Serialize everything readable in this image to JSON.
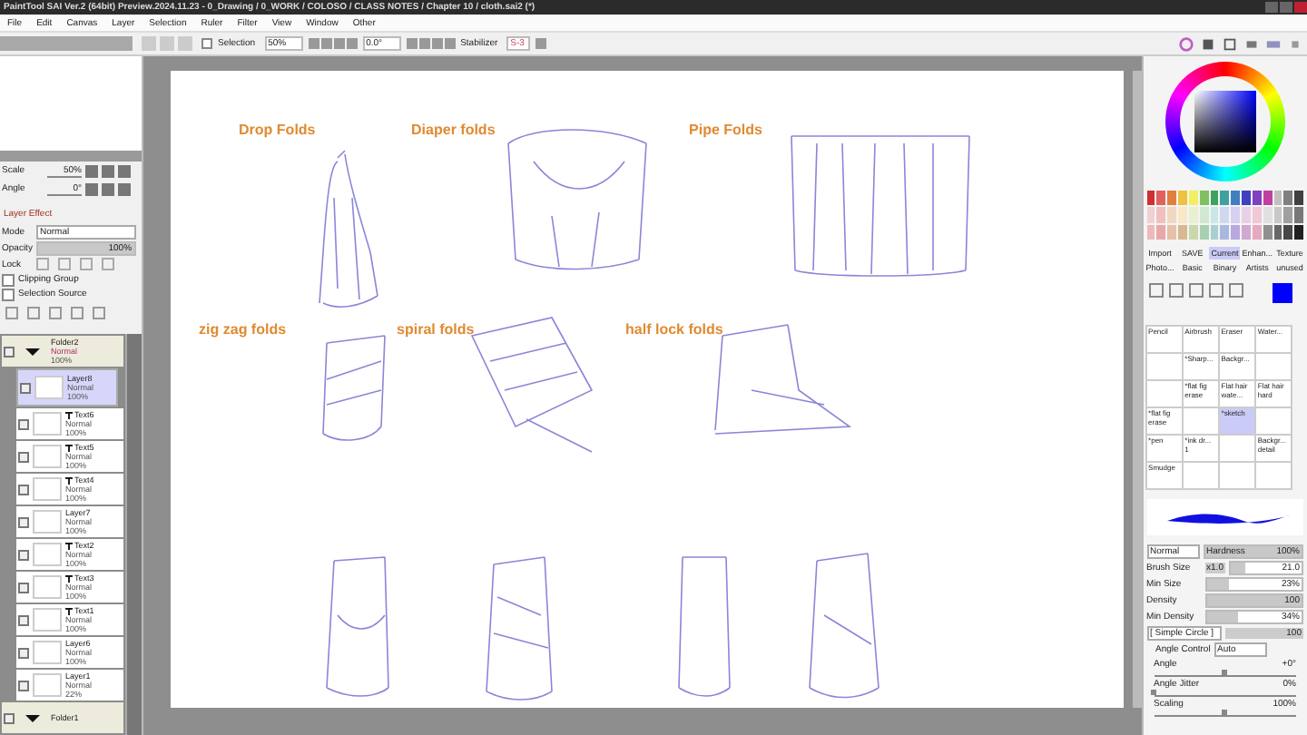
{
  "window": {
    "title": "PaintTool SAI Ver.2 (64bit) Preview.2024.11.23 - 0_Drawing / 0_WORK / COLOSO / CLASS NOTES / Chapter 10 / cloth.sai2 (*)"
  },
  "menu": [
    "File",
    "Edit",
    "Canvas",
    "Layer",
    "Selection",
    "Ruler",
    "Filter",
    "View",
    "Window",
    "Other"
  ],
  "toolbar": {
    "selection_label": "Selection",
    "zoom": "50%",
    "angle": "0.0°",
    "stabilizer_label": "Stabilizer",
    "stabilizer": "S-3"
  },
  "navigator": {
    "scale_label": "Scale",
    "scale": "50%",
    "angle_label": "Angle",
    "angle": "0°"
  },
  "layer_panel": {
    "effect": "Layer Effect",
    "mode_label": "Mode",
    "mode": "Normal",
    "opacity_label": "Opacity",
    "opacity": {
      "text": "100%",
      "level": 1
    },
    "lock_label": "Lock",
    "clipping_group": {
      "label": "Clipping Group",
      "checked": false
    },
    "selection_source": {
      "label": "Selection Source",
      "checked": false
    }
  },
  "layers": [
    {
      "kind": "folder",
      "name": "Folder2",
      "mode": "Normal",
      "opacity": "100%",
      "selected": false
    },
    {
      "kind": "layer",
      "name": "Layer8",
      "mode": "Normal",
      "opacity": "100%",
      "selected": true
    },
    {
      "kind": "text",
      "name": "Text6",
      "mode": "Normal",
      "opacity": "100%",
      "selected": false
    },
    {
      "kind": "text",
      "name": "Text5",
      "mode": "Normal",
      "opacity": "100%",
      "selected": false
    },
    {
      "kind": "text",
      "name": "Text4",
      "mode": "Normal",
      "opacity": "100%",
      "selected": false
    },
    {
      "kind": "layer",
      "name": "Layer7",
      "mode": "Normal",
      "opacity": "100%",
      "selected": false
    },
    {
      "kind": "text",
      "name": "Text2",
      "mode": "Normal",
      "opacity": "100%",
      "selected": false
    },
    {
      "kind": "text",
      "name": "Text3",
      "mode": "Normal",
      "opacity": "100%",
      "selected": false
    },
    {
      "kind": "text",
      "name": "Text1",
      "mode": "Normal",
      "opacity": "100%",
      "selected": false
    },
    {
      "kind": "layer",
      "name": "Layer6",
      "mode": "Normal",
      "opacity": "100%",
      "selected": false
    },
    {
      "kind": "layer",
      "name": "Layer1",
      "mode": "Normal",
      "opacity": "22%",
      "selected": false
    },
    {
      "kind": "folder",
      "name": "Folder1",
      "selected": false
    }
  ],
  "canvas": {
    "labels": [
      "Drop Folds",
      "Diaper folds",
      "Pipe Folds",
      "zig zag folds",
      "spiral folds",
      "half lock folds"
    ]
  },
  "brush_sets": [
    {
      "label": "Import",
      "selected": false
    },
    {
      "label": "SAVE",
      "selected": false
    },
    {
      "label": "Current",
      "selected": true
    },
    {
      "label": "Enhan...",
      "selected": false
    },
    {
      "label": "Texture",
      "selected": false
    },
    {
      "label": "Photo...",
      "selected": false
    },
    {
      "label": "Basic",
      "selected": false
    },
    {
      "label": "Binary",
      "selected": false
    },
    {
      "label": "Artists",
      "selected": false
    },
    {
      "label": "unused",
      "selected": false
    }
  ],
  "brushes": [
    {
      "name": "Pencil",
      "selected": false
    },
    {
      "name": "Airbrush",
      "selected": false
    },
    {
      "name": "Eraser",
      "selected": false
    },
    {
      "name": "Water...",
      "selected": false
    },
    {
      "selected": false
    },
    {
      "name": "*Sharp...",
      "selected": false
    },
    {
      "name": "Backgr...",
      "selected": false
    },
    {
      "selected": false
    },
    {
      "selected": false
    },
    {
      "name": "*flat fig erase",
      "selected": false
    },
    {
      "name": "Flat hair wate...",
      "selected": false
    },
    {
      "name": "Flat hair hard",
      "selected": false
    },
    {
      "name": "*flat fig erase",
      "selected": false
    },
    {
      "selected": false
    },
    {
      "name": "*sketch",
      "selected": true
    },
    {
      "selected": false
    },
    {
      "name": "*pen",
      "selected": false
    },
    {
      "name": "*ink dr... 1",
      "selected": false
    },
    {
      "selected": false
    },
    {
      "name": "Backgr... detail",
      "selected": false
    },
    {
      "name": "Smudge",
      "selected": false
    },
    {
      "selected": false
    },
    {
      "selected": false
    },
    {
      "selected": false
    }
  ],
  "brush_settings": {
    "blend": "Normal",
    "hardness_label": "Hardness",
    "hardness": {
      "text": "100%",
      "level": 1
    },
    "rows": [
      {
        "label": "Brush Size",
        "multiplier": "x1.0",
        "value": "21.0",
        "level": 0.21
      },
      {
        "label": "Min Size",
        "value": "23%",
        "level": 0.23
      },
      {
        "label": "Density",
        "value": "100",
        "level": 1
      },
      {
        "label": "Min Density",
        "value": "34%",
        "level": 0.34
      }
    ],
    "shape": "[ Simple Circle ]",
    "shape_max": "100",
    "angle_control_label": "Angle Control",
    "angle_control": "Auto",
    "sliders": [
      {
        "label": "Angle",
        "value": "+0°",
        "level": 0.5
      },
      {
        "label": "Angle Jitter",
        "value": "0%",
        "level": 0
      },
      {
        "label": "Scaling",
        "value": "100%",
        "level": 0.5
      }
    ]
  }
}
